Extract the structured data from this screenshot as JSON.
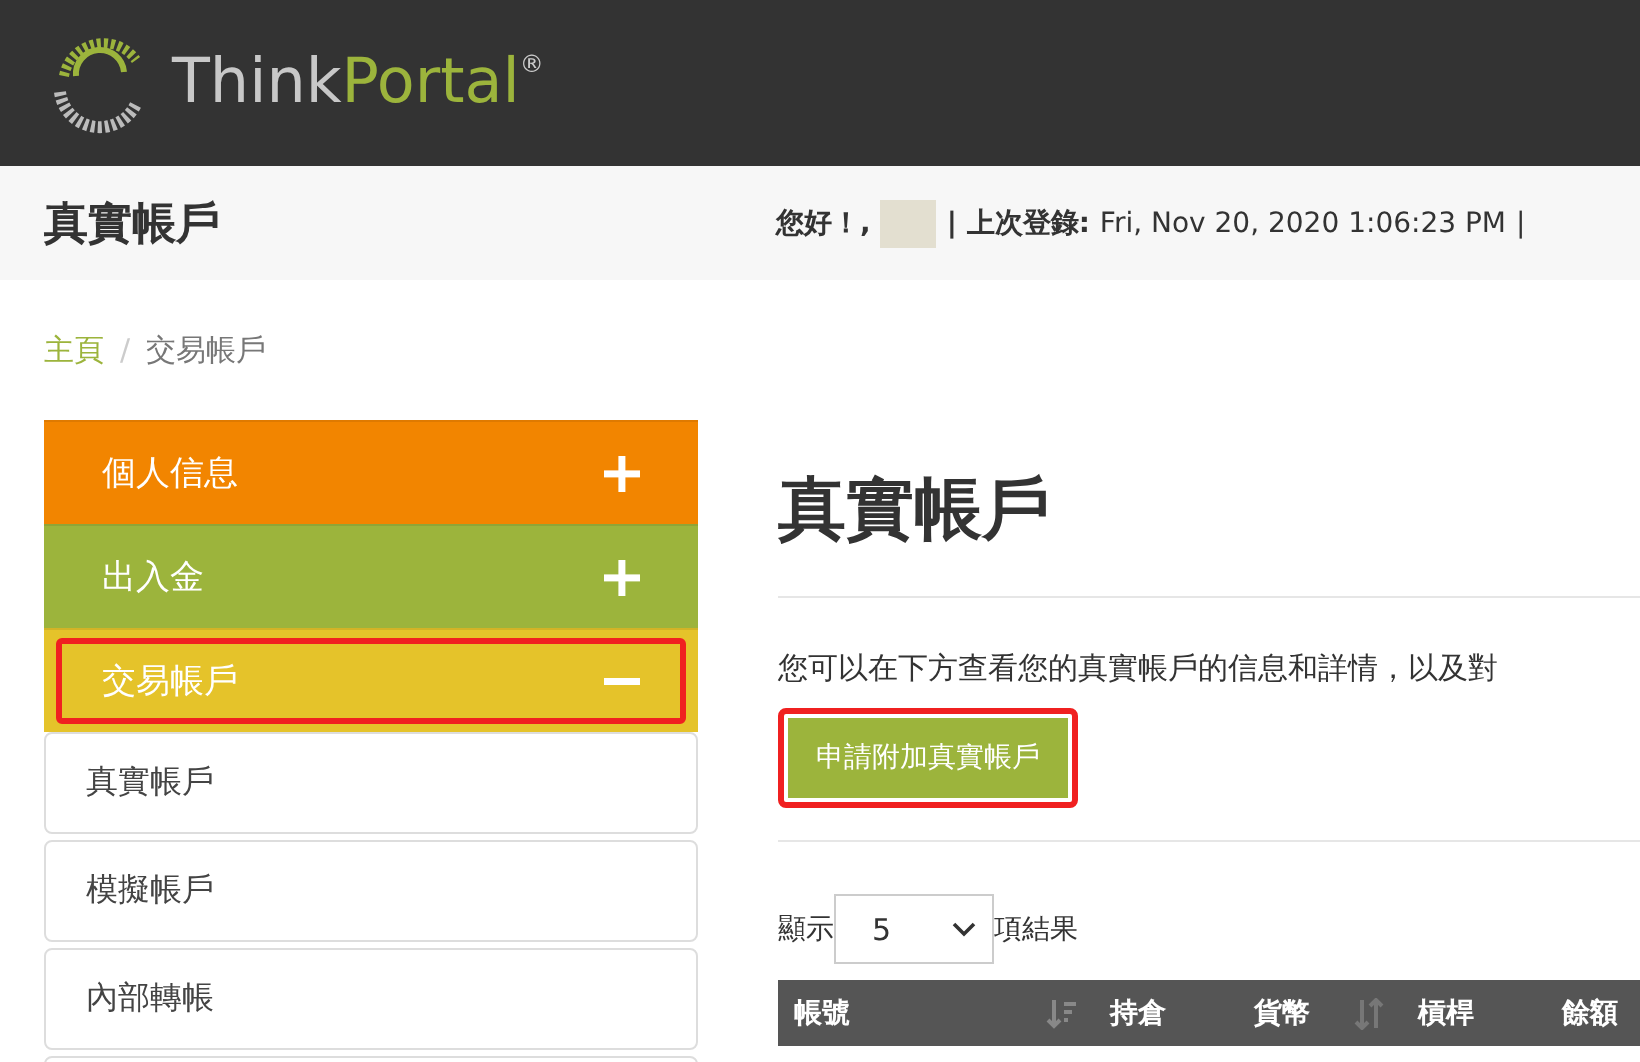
{
  "brand": {
    "name_part_1": "Think",
    "name_part_2": "Portal",
    "mark": "®"
  },
  "subheader": {
    "title": "真實帳戶",
    "greeting": "您好！,",
    "last_login_label": "| 上次登錄:",
    "last_login": "Fri, Nov 20, 2020 1:06:23 PM",
    "separator": "|"
  },
  "breadcrumb": [
    {
      "label": "主頁",
      "link": true
    },
    {
      "label": "交易帳戶",
      "link": false
    }
  ],
  "breadcrumb_separator": "/",
  "sidebar": {
    "groups": [
      {
        "label": "個人信息",
        "color": "#f28500",
        "expanded": false,
        "highlighted": false
      },
      {
        "label": "出入金",
        "color": "#9cb43c",
        "expanded": false,
        "highlighted": false
      },
      {
        "label": "交易帳戶",
        "color": "#e5c32a",
        "expanded": true,
        "highlighted": true,
        "children": [
          {
            "label": "真實帳戶"
          },
          {
            "label": "模擬帳戶"
          },
          {
            "label": "內部轉帳"
          }
        ]
      }
    ]
  },
  "main": {
    "title": "真實帳戶",
    "description": "您可以在下方查看您的真實帳戶的信息和詳情，以及對",
    "button": {
      "label": "申請附加真實帳戶",
      "highlighted": true
    },
    "length": {
      "prefix": "顯示",
      "value": "5",
      "suffix": "項結果"
    },
    "table": {
      "columns": [
        {
          "label": "帳號",
          "kind": "sorted"
        },
        {
          "label": "持倉",
          "kind": "plain"
        },
        {
          "label": "貨幣",
          "kind": "sortable"
        },
        {
          "label": "槓桿",
          "kind": "plain"
        },
        {
          "label": "餘額",
          "kind": "plain"
        }
      ]
    }
  }
}
